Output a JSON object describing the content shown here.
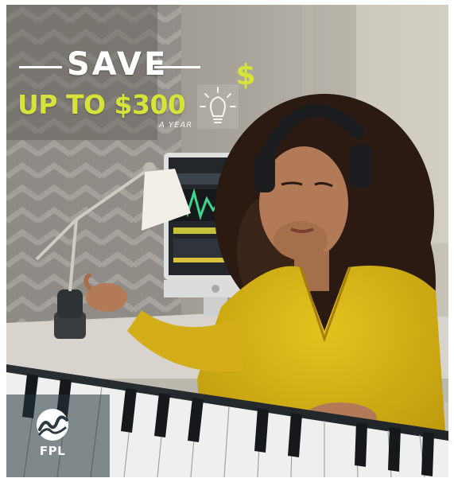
{
  "ad": {
    "headline_save": "SAVE",
    "headline_amount": "UP TO $300",
    "headline_period": "A YEAR",
    "dollar_symbol": "$",
    "brand_name": "FPL",
    "accent_color": "#d6e33a",
    "icons": [
      "lightbulb-icon",
      "dollar-sign-icon",
      "fpl-logo-icon"
    ]
  }
}
